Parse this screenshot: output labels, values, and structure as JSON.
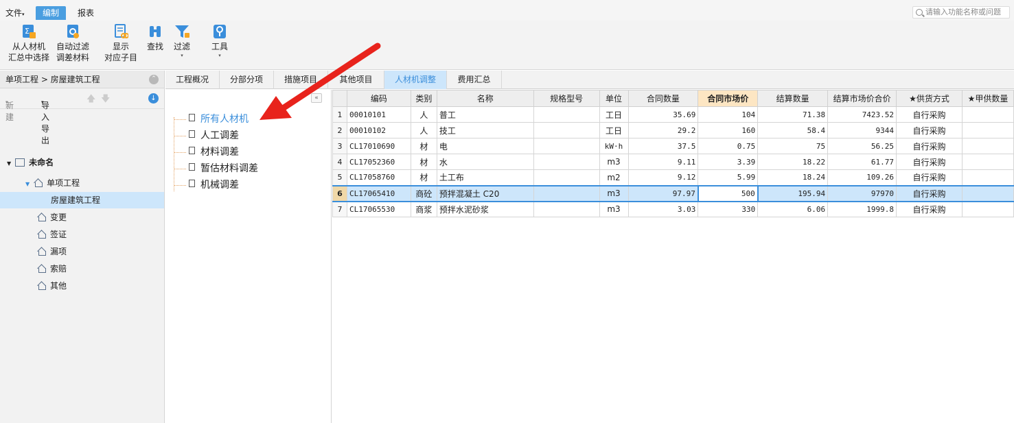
{
  "menubar": {
    "items": [
      {
        "label": "文件",
        "caret": "▾"
      },
      {
        "label": "编制"
      },
      {
        "label": "报表"
      }
    ],
    "search_placeholder": "请输入功能名称或问题"
  },
  "ribbon": {
    "buttons": [
      {
        "line1": "从人材机",
        "line2": "汇总中选择",
        "icon": "sigma-icon"
      },
      {
        "line1": "自动过滤",
        "line2": "调差材料",
        "icon": "gear-doc-icon"
      },
      {
        "line1": "显示",
        "line2": "对应子目",
        "icon": "link-doc-icon"
      },
      {
        "line1": "查找",
        "line2": "",
        "icon": "binoculars-icon"
      },
      {
        "line1": "过滤",
        "line2": "▾",
        "icon": "filter-icon"
      },
      {
        "line1": "工具",
        "line2": "▾",
        "icon": "wrench-icon"
      }
    ]
  },
  "left": {
    "breadcrumb": "单项工程 > 房屋建筑工程",
    "new_label": "新建",
    "import_export_label": "导入导出",
    "tree": {
      "root": "未命名",
      "group": "单项工程",
      "selected": "房屋建筑工程",
      "items": [
        "变更",
        "签证",
        "漏项",
        "索赔",
        "其他"
      ]
    }
  },
  "tabs": [
    "工程概况",
    "分部分项",
    "措施项目",
    "其他项目",
    "人材机调整",
    "费用汇总"
  ],
  "middle": {
    "nodes": [
      "所有人材机",
      "人工调差",
      "材料调差",
      "暂估材料调差",
      "机械调差"
    ]
  },
  "grid": {
    "headers": [
      "",
      "编码",
      "类别",
      "名称",
      "规格型号",
      "单位",
      "合同数量",
      "合同市场价",
      "结算数量",
      "结算市场价合价",
      "★供货方式",
      "★甲供数量"
    ],
    "rows": [
      {
        "n": "1",
        "code": "00010101",
        "cat": "人",
        "name": "普工",
        "spec": "",
        "unit": "工日",
        "qty": "35.69",
        "price": "104",
        "sqty": "71.38",
        "total": "7423.52",
        "supply": "自行采购",
        "jia": ""
      },
      {
        "n": "2",
        "code": "00010102",
        "cat": "人",
        "name": "技工",
        "spec": "",
        "unit": "工日",
        "qty": "29.2",
        "price": "160",
        "sqty": "58.4",
        "total": "9344",
        "supply": "自行采购",
        "jia": ""
      },
      {
        "n": "3",
        "code": "CL17010690",
        "cat": "材",
        "name": "电",
        "spec": "",
        "unit": "kW·h",
        "qty": "37.5",
        "price": "0.75",
        "sqty": "75",
        "total": "56.25",
        "supply": "自行采购",
        "jia": ""
      },
      {
        "n": "4",
        "code": "CL17052360",
        "cat": "材",
        "name": "水",
        "spec": "",
        "unit": "m3",
        "qty": "9.11",
        "price": "3.39",
        "sqty": "18.22",
        "total": "61.77",
        "supply": "自行采购",
        "jia": ""
      },
      {
        "n": "5",
        "code": "CL17058760",
        "cat": "材",
        "name": "土工布",
        "spec": "",
        "unit": "m2",
        "qty": "9.12",
        "price": "5.99",
        "sqty": "18.24",
        "total": "109.26",
        "supply": "自行采购",
        "jia": ""
      },
      {
        "n": "6",
        "code": "CL17065410",
        "cat": "商砼",
        "name": "预拌混凝土 C20",
        "spec": "",
        "unit": "m3",
        "qty": "97.97",
        "price": "500",
        "sqty": "195.94",
        "total": "97970",
        "supply": "自行采购",
        "jia": ""
      },
      {
        "n": "7",
        "code": "CL17065530",
        "cat": "商浆",
        "name": "预拌水泥砂浆",
        "spec": "",
        "unit": "m3",
        "qty": "3.03",
        "price": "330",
        "sqty": "6.06",
        "total": "1999.8",
        "supply": "自行采购",
        "jia": ""
      }
    ]
  },
  "colors": {
    "accent": "#3a8edb",
    "selected_bg": "#cde6fb",
    "arrow": "#e8231c"
  }
}
